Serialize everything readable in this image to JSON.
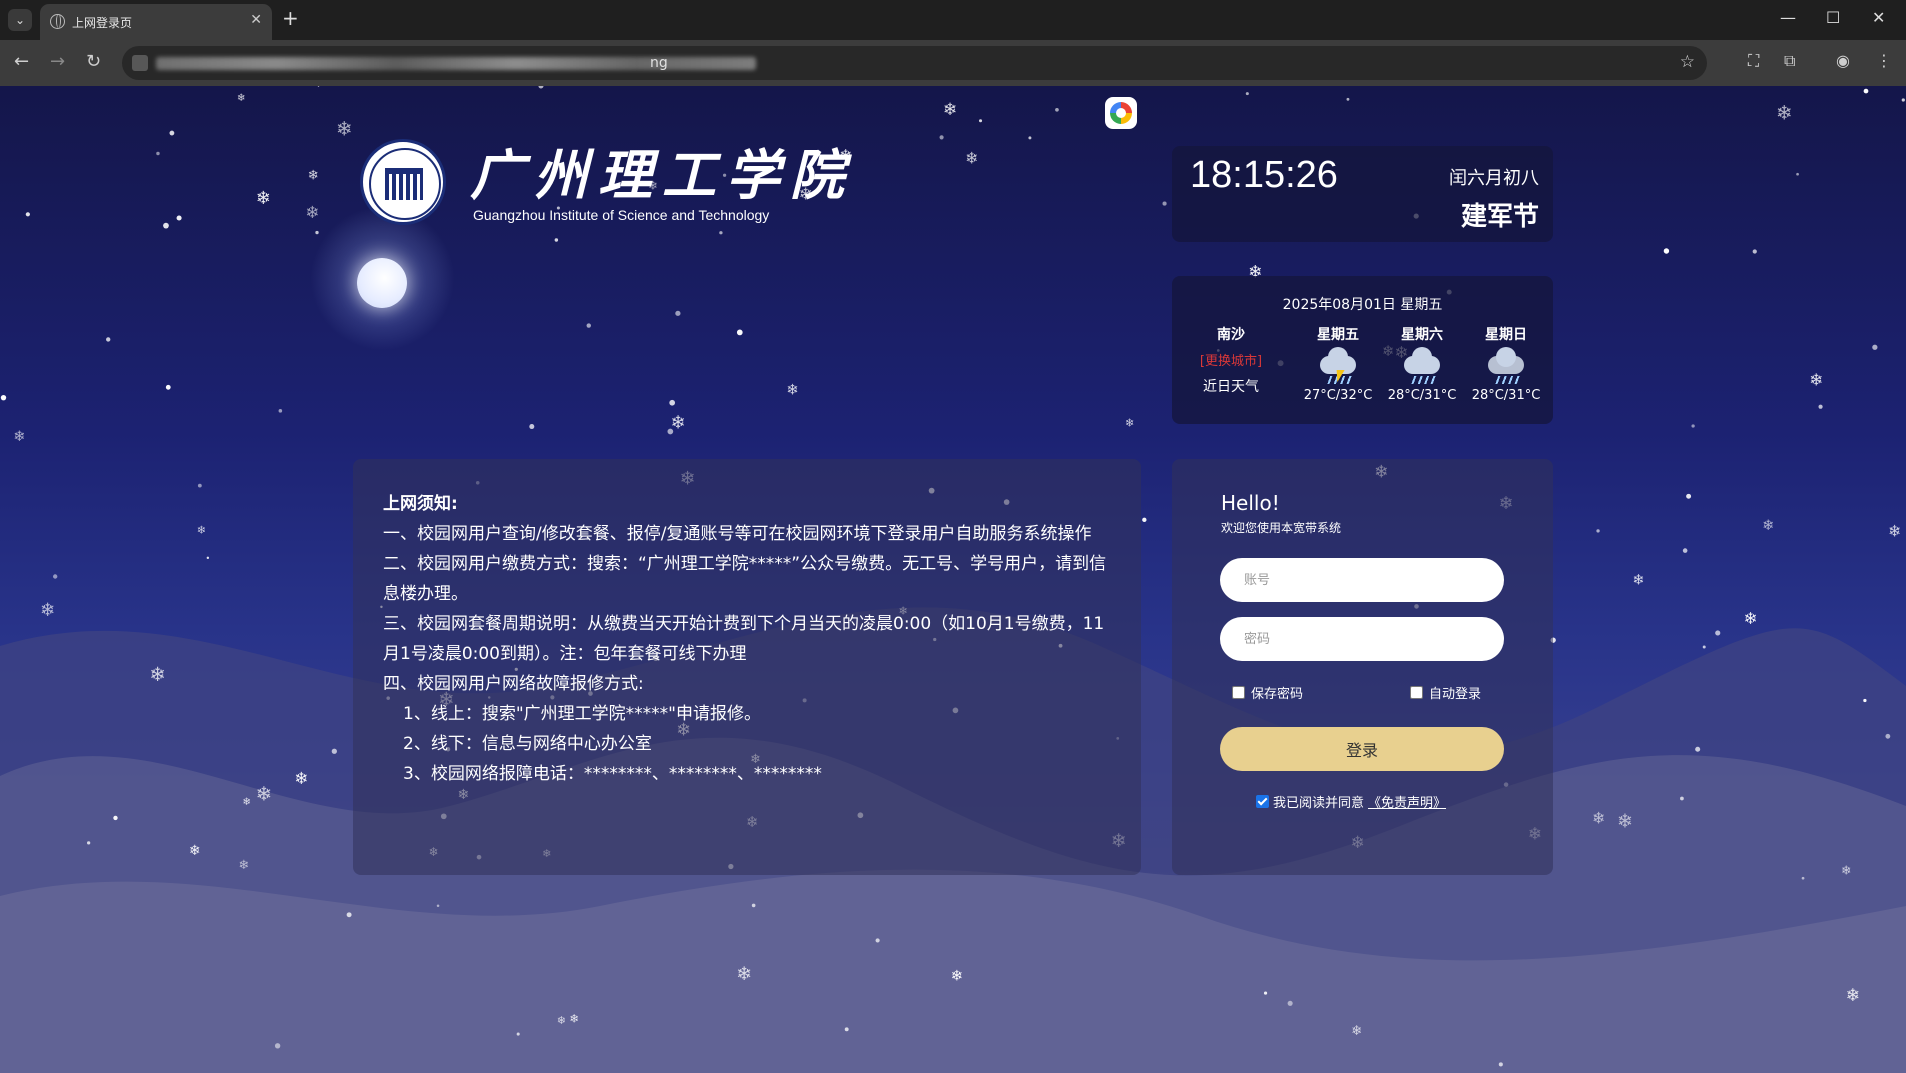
{
  "browser": {
    "tab_title": "上网登录页",
    "url_suffix": "ng"
  },
  "logo": {
    "cn_name": "广州理工学院",
    "en_name": "Guangzhou Institute of Science and Technology"
  },
  "clock": {
    "time": "18:15:26",
    "lunar_date": "闰六月初八",
    "festival": "建军节"
  },
  "weather": {
    "date": "2025年08月01日 星期五",
    "city": "南沙",
    "change_city": "[更换城市]",
    "recent_label": "近日天气",
    "days": [
      {
        "name": "星期五",
        "icon": "thunderstorm-icon",
        "temp": "27°C/32°C"
      },
      {
        "name": "星期六",
        "icon": "rain-icon",
        "temp": "28°C/31°C"
      },
      {
        "name": "星期日",
        "icon": "rain-icon",
        "temp": "28°C/31°C"
      }
    ]
  },
  "notice": {
    "title": "上网须知:",
    "lines": [
      "一、校园网用户查询/修改套餐、报停/复通账号等可在校园网环境下登录用户自助服务系统操作",
      "二、校园网用户缴费方式：搜索：“广州理工学院*****”公众号缴费。无工号、学号用户，请到信息楼办理。",
      "三、校园网套餐周期说明：从缴费当天开始计费到下个月当天的凌晨0:00（如10月1号缴费，11月1号凌晨0:00到期）。注：包年套餐可线下办理",
      "四、校园网用户网络故障报修方式:"
    ],
    "sub_lines": [
      "1、线上：搜索\"广州理工学院*****\"申请报修。",
      "2、线下：信息与网络中心办公室",
      "3、校园网络报障电话：********、********、********"
    ]
  },
  "login": {
    "hello": "Hello!",
    "welcome": "欢迎您使用本宽带系统",
    "account_placeholder": "账号",
    "password_placeholder": "密码",
    "save_password": "保存密码",
    "auto_login": "自动登录",
    "login_button": "登录",
    "agree_text": "我已阅读并同意",
    "disclaimer_link": "《免责声明》",
    "agree_checked": true
  }
}
